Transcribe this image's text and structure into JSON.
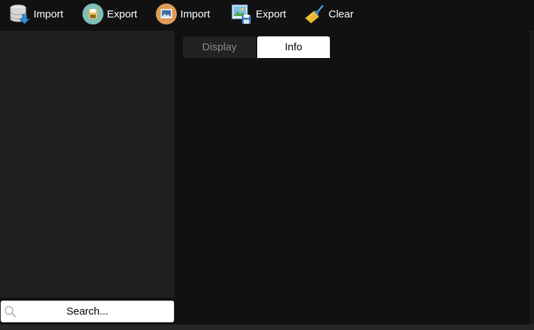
{
  "toolbar": {
    "buttons": [
      {
        "label": "Import",
        "icon": "database-import-icon"
      },
      {
        "label": "Export",
        "icon": "save-disk-icon"
      },
      {
        "label": "Import",
        "icon": "image-import-icon"
      },
      {
        "label": "Export",
        "icon": "image-export-icon"
      },
      {
        "label": "Clear",
        "icon": "broom-clear-icon"
      }
    ]
  },
  "tabs": [
    {
      "label": "Display",
      "active": false
    },
    {
      "label": "Info",
      "active": true
    }
  ],
  "search": {
    "placeholder": "Search...",
    "value": ""
  },
  "colors": {
    "background": "#111111",
    "panel": "#1f1f1f",
    "tab_inactive": "#222222",
    "tab_active": "#ffffff",
    "export_icon_bg": "#7fbfba",
    "image_import_icon_bg": "#e09a5c"
  }
}
